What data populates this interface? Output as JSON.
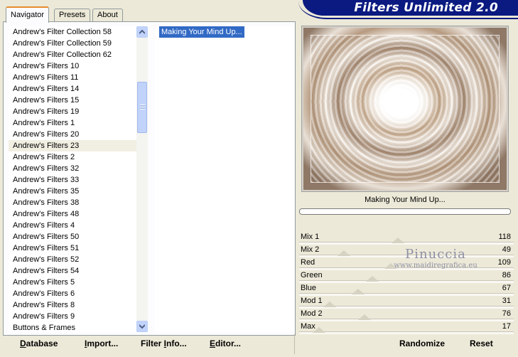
{
  "tabs": [
    {
      "label": "Navigator",
      "active": true
    },
    {
      "label": "Presets",
      "active": false
    },
    {
      "label": "About",
      "active": false
    }
  ],
  "app_title": "Filters Unlimited 2.0",
  "categories": [
    "Andrew's Filter Collection 58",
    "Andrew's Filter Collection 59",
    "Andrew's Filter Collection 62",
    "Andrew's Filters 10",
    "Andrew's Filters 11",
    "Andrew's Filters 14",
    "Andrew's Filters 15",
    "Andrew's Filters 19",
    "Andrew's Filters 1",
    "Andrew's Filters 20",
    "Andrew's Filters 23",
    "Andrew's Filters 2",
    "Andrew's Filters 32",
    "Andrew's Filters 33",
    "Andrew's Filters 35",
    "Andrew's Filters 38",
    "Andrew's Filters 48",
    "Andrew's Filters 4",
    "Andrew's Filters 50",
    "Andrew's Filters 51",
    "Andrew's Filters 52",
    "Andrew's Filters 54",
    "Andrew's Filters 5",
    "Andrew's Filters 6",
    "Andrew's Filters 8",
    "Andrew's Filters 9",
    "Buttons & Frames"
  ],
  "selected_category": "Andrew's Filters 23",
  "filters": [
    "Making Your Mind Up..."
  ],
  "selected_filter": "Making Your Mind Up...",
  "preview_label": "Making Your Mind Up...",
  "parameters": [
    {
      "label": "Mix 1",
      "value": 118,
      "max": 255
    },
    {
      "label": "Mix 2",
      "value": 49,
      "max": 255
    },
    {
      "label": "Red",
      "value": 109,
      "max": 255
    },
    {
      "label": "Green",
      "value": 86,
      "max": 255
    },
    {
      "label": "Blue",
      "value": 67,
      "max": 255
    },
    {
      "label": "Mod 1",
      "value": 31,
      "max": 255
    },
    {
      "label": "Mod 2",
      "value": 76,
      "max": 255
    },
    {
      "label": "Max",
      "value": 17,
      "max": 255
    }
  ],
  "watermark": {
    "name": "Pinuccia",
    "site": "www.maidiregrafica.eu"
  },
  "buttons": {
    "database": {
      "u": "D",
      "rest": "atabase"
    },
    "import": {
      "u": "I",
      "rest": "mport..."
    },
    "filter_info": {
      "pre": "Filter ",
      "u": "I",
      "rest": "nfo..."
    },
    "editor": {
      "u": "E",
      "rest": "ditor..."
    },
    "randomize": "Randomize",
    "reset": "Reset"
  },
  "colors": {
    "banner": "#0a1a80",
    "selection": "#316ac5",
    "tab_accent": "#e68b2c"
  }
}
